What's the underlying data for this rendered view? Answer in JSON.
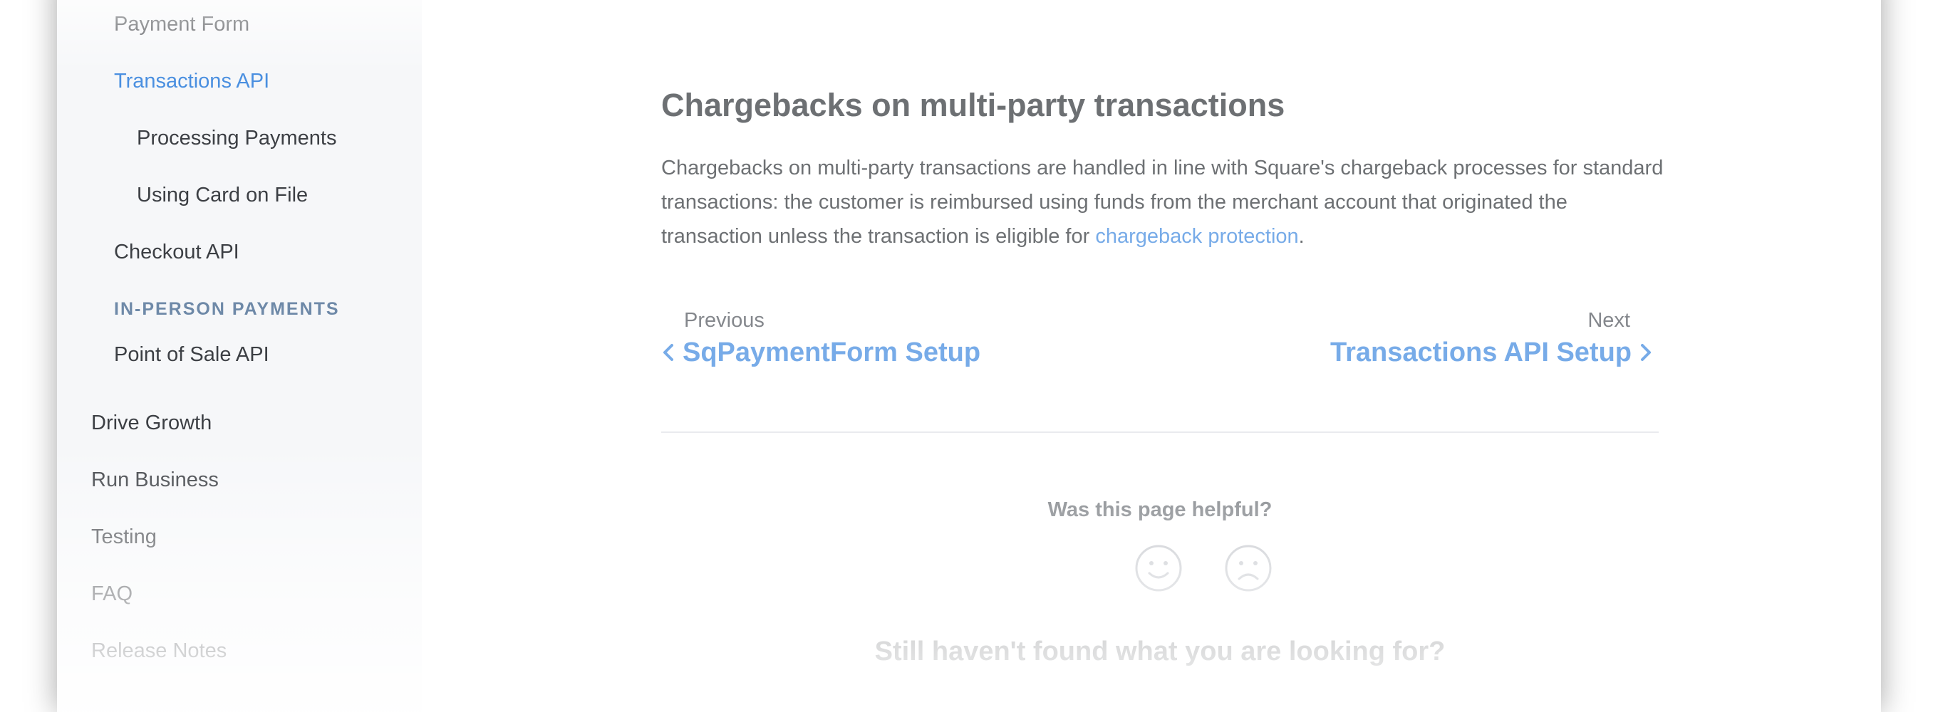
{
  "sidebar": {
    "items": [
      {
        "label": "Payment Form"
      },
      {
        "label": "Transactions API"
      },
      {
        "label": "Processing Payments"
      },
      {
        "label": "Using Card on File"
      },
      {
        "label": "Checkout API"
      },
      {
        "label": "IN-PERSON PAYMENTS"
      },
      {
        "label": "Point of Sale API"
      },
      {
        "label": "Drive Growth"
      },
      {
        "label": "Run Business"
      },
      {
        "label": "Testing"
      },
      {
        "label": "FAQ"
      },
      {
        "label": "Release Notes"
      }
    ]
  },
  "main": {
    "title": "Chargebacks on multi-party transactions",
    "paragraph_text": "Chargebacks on multi-party transactions are handled in line with Square's chargeback processes for standard transactions: the customer is reimbursed using funds from the merchant account that originated the transaction unless the transaction is eligible for ",
    "paragraph_link": "chargeback protection",
    "paragraph_end": ".",
    "pager": {
      "prev_caption": "Previous",
      "prev_label": "SqPaymentForm Setup",
      "next_caption": "Next",
      "next_label": "Transactions API Setup"
    },
    "feedback": {
      "question": "Was this page helpful?",
      "happy_icon": "smiley-face-icon",
      "sad_icon": "frowning-face-icon"
    },
    "still_looking": "Still haven't found what you are looking for?"
  },
  "colors": {
    "accent": "#4a8fe0",
    "text": "#3c4045",
    "heading_muted": "#6e89a8"
  }
}
